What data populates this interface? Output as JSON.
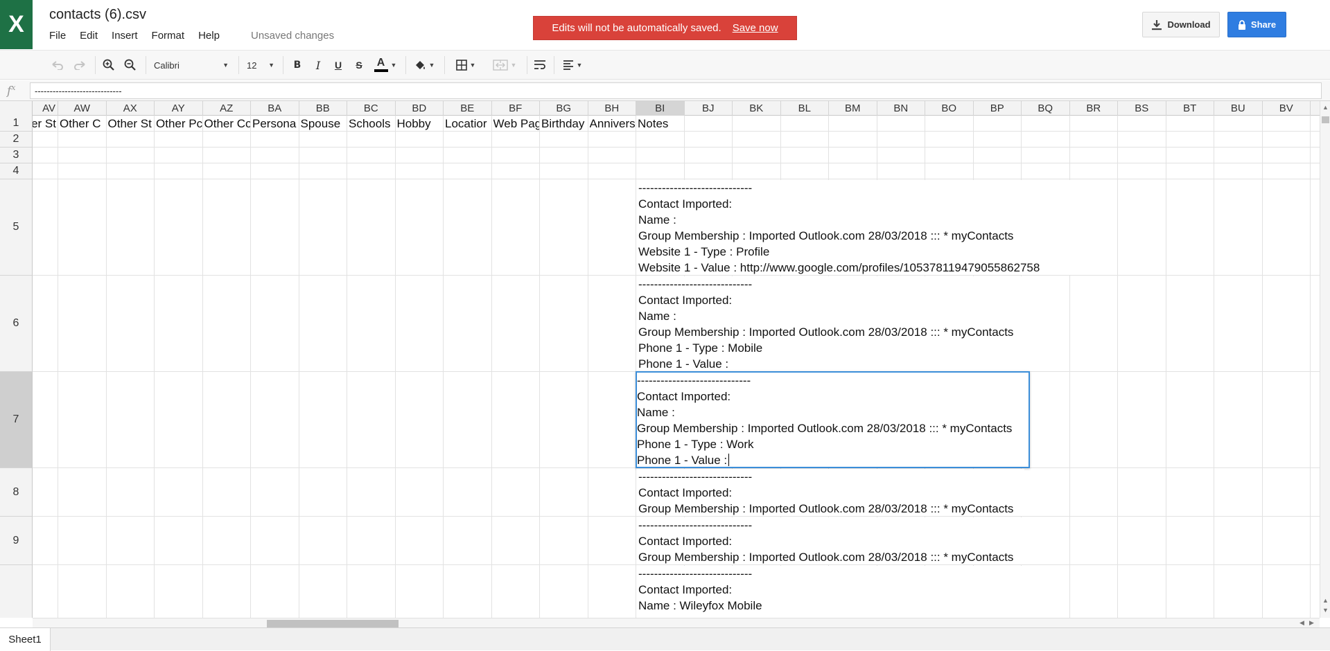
{
  "app": {
    "logo_letter": "X",
    "brand_color": "#1e7145"
  },
  "document": {
    "title": "contacts (6).csv",
    "status": "Unsaved changes"
  },
  "menu": [
    "File",
    "Edit",
    "Insert",
    "Format",
    "Help"
  ],
  "banner": {
    "message": "Edits will not be automatically saved.",
    "action": "Save now",
    "color": "#d9423a"
  },
  "actions": {
    "download": "Download",
    "share": "Share",
    "share_color": "#2f7de1"
  },
  "toolbar": {
    "font_family": "Calibri",
    "font_size": "12",
    "bold": "B",
    "italic": "I",
    "underline": "U",
    "strike": "S",
    "text_color": "A",
    "icons": [
      "undo-icon",
      "redo-icon",
      "zoom-in-icon",
      "zoom-out-icon",
      "bold-icon",
      "italic-icon",
      "underline-icon",
      "strikethrough-icon",
      "text-color-icon",
      "fill-color-icon",
      "borders-icon",
      "merge-cells-icon",
      "wrap-text-icon",
      "align-icon"
    ]
  },
  "formula_bar": {
    "label": "fx",
    "value": "-----------------------------"
  },
  "grid": {
    "columns": [
      "AV",
      "AW",
      "AX",
      "AY",
      "AZ",
      "BA",
      "BB",
      "BC",
      "BD",
      "BE",
      "BF",
      "BG",
      "BH",
      "BI",
      "BJ",
      "BK",
      "BL",
      "BM",
      "BN",
      "BO",
      "BP",
      "BQ",
      "BR",
      "BS",
      "BT",
      "BU",
      "BV"
    ],
    "selected_column": "BI",
    "rows": [
      "1",
      "2",
      "3",
      "4",
      "5",
      "6",
      "7",
      "8",
      "9",
      ""
    ],
    "selected_row": "7",
    "header_row": [
      "er St",
      "Other C",
      "Other St",
      "Other Pc",
      "Other Co",
      "Persona",
      "Spouse",
      "Schools",
      "Hobby",
      "Locatior",
      "Web Pag",
      "Birthday",
      "Annivers",
      "Notes"
    ],
    "notes": {
      "r5": [
        "-----------------------------",
        "Contact Imported:",
        "Name :",
        "Group Membership : Imported Outlook.com 28/03/2018 ::: * myContacts",
        "Website 1 - Type : Profile",
        "Website 1 - Value : http://www.google.com/profiles/105378119479055862758"
      ],
      "r6": [
        "-----------------------------",
        "Contact Imported:",
        "Name :",
        "Group Membership : Imported Outlook.com 28/03/2018 ::: * myContacts",
        "Phone 1 - Type : Mobile",
        "Phone 1 - Value :"
      ],
      "r7": [
        "-----------------------------",
        "Contact Imported:",
        "Name :",
        "Group Membership : Imported Outlook.com 28/03/2018 ::: * myContacts",
        "Phone 1 - Type : Work",
        "Phone 1 - Value :"
      ],
      "r8": [
        "-----------------------------",
        "Contact Imported:",
        "Group Membership : Imported Outlook.com 28/03/2018 ::: * myContacts"
      ],
      "r9": [
        "-----------------------------",
        "Contact Imported:",
        "Group Membership : Imported Outlook.com 28/03/2018 ::: * myContacts"
      ],
      "r10": [
        "-----------------------------",
        "Contact Imported:",
        "Name : Wileyfox Mobile"
      ]
    }
  },
  "sheets": [
    "Sheet1"
  ]
}
